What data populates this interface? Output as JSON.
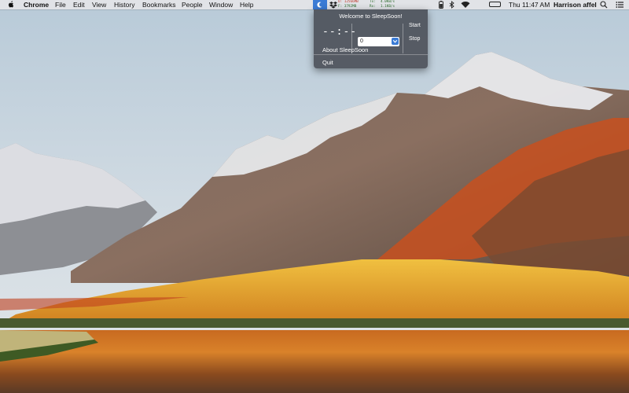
{
  "menubar": {
    "app_name": "Chrome",
    "menus": [
      "File",
      "Edit",
      "View",
      "History",
      "Bookmarks",
      "People",
      "Window",
      "Help"
    ],
    "clock": "Thu 11:47 AM",
    "user": "Harrison affel",
    "battery_text": "",
    "stats": {
      "row1_a": "U: 12566MB",
      "row1_b": "Tx:",
      "row1_c": "4.0KB/s",
      "row2_a": "F:   3792MB",
      "row2_b": "Rx:",
      "row2_c": "1.1KB/s"
    }
  },
  "sleepsoon": {
    "title": "Welcome to SleepSoon!",
    "timer": "--:--",
    "minutes_value": "0",
    "start_label": "Start",
    "stop_label": "Stop",
    "about_label": "About SleepSoon",
    "quit_label": "Quit"
  },
  "colors": {
    "accent": "#3a7bd5",
    "menu_bg": "#4e525a"
  },
  "icons": [
    "apple-icon",
    "dropbox-icon",
    "battery-small-icon",
    "bluetooth-icon",
    "wifi-icon",
    "battery-icon",
    "search-icon",
    "notification-center-icon",
    "chevron-down-icon"
  ]
}
